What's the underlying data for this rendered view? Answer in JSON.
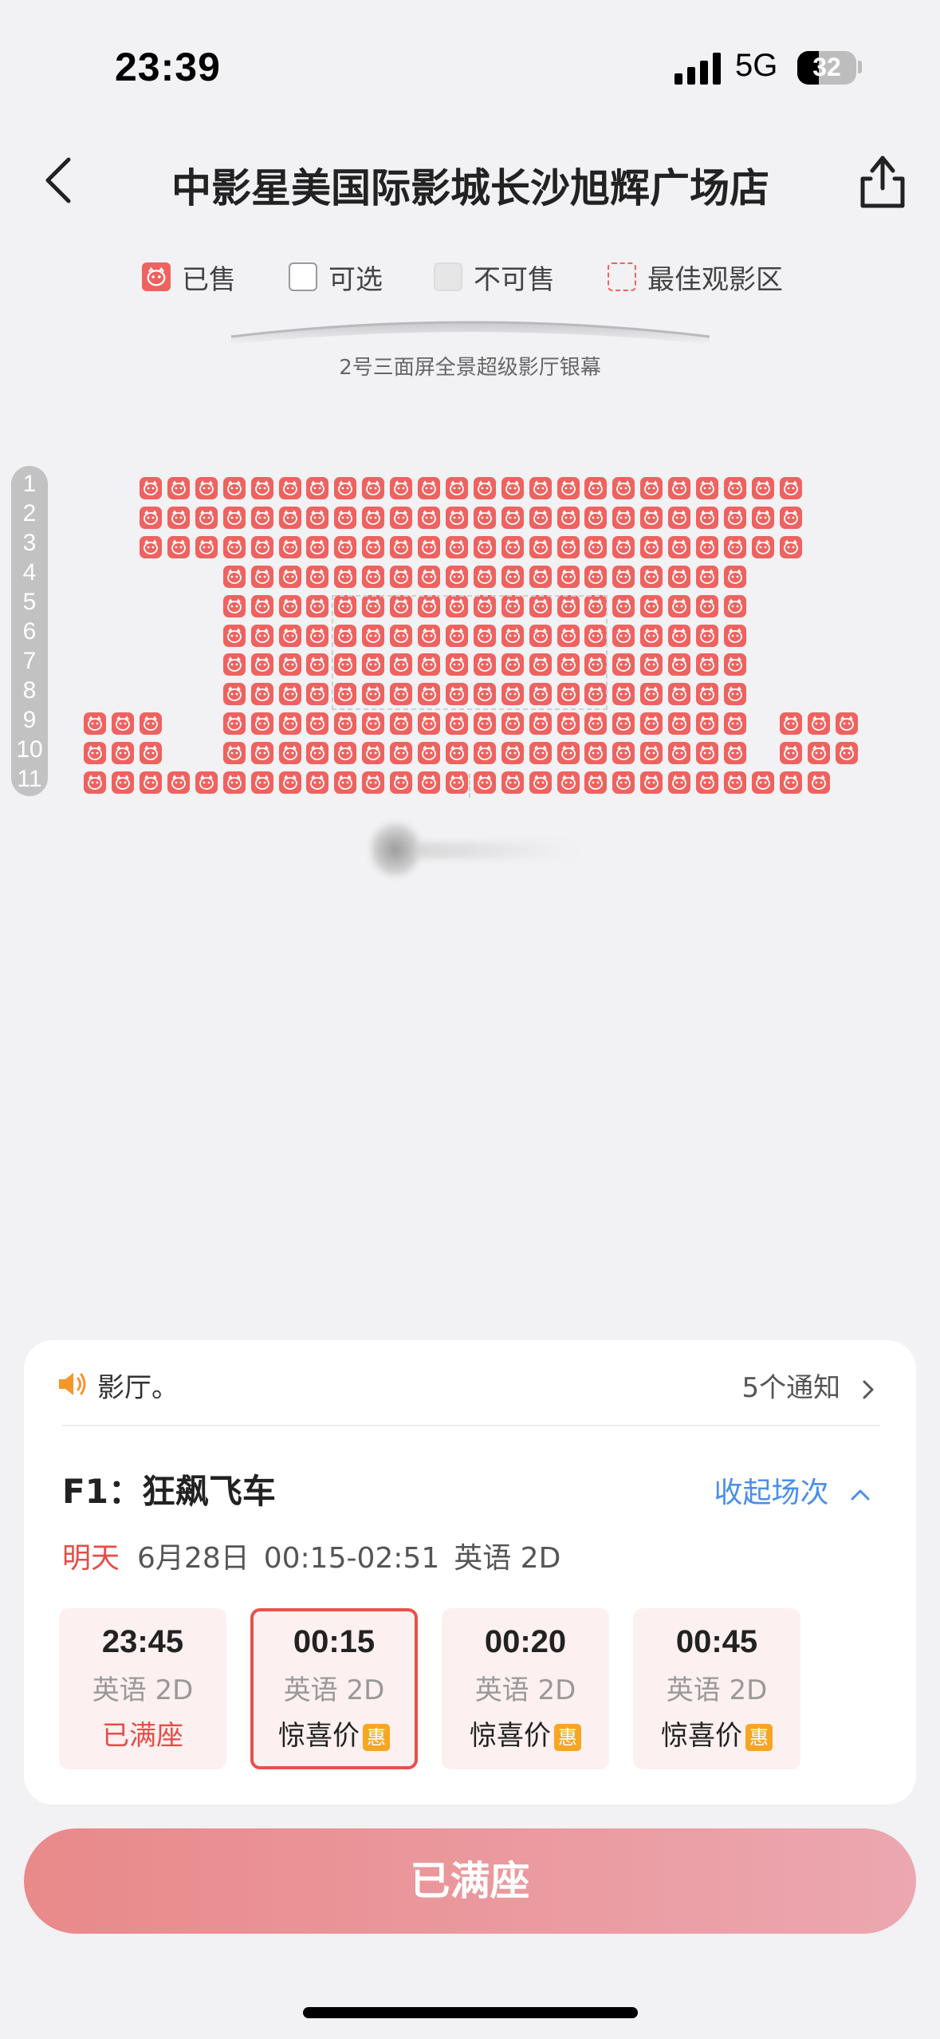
{
  "status_bar": {
    "time": "23:39",
    "network": "5G",
    "battery": "32"
  },
  "nav": {
    "title": "中影星美国际影城长沙旭辉广场店",
    "back_icon": "chevron-left-icon",
    "share_icon": "share-icon"
  },
  "legend": {
    "sold": "已售",
    "available": "可选",
    "unavailable": "不可售",
    "best_zone": "最佳观影区"
  },
  "screen": {
    "label": "2号三面屏全景超级影厅银幕"
  },
  "rows": [
    "1",
    "2",
    "3",
    "4",
    "5",
    "6",
    "7",
    "8",
    "9",
    "10",
    "11"
  ],
  "seat_status": "sold",
  "notice": {
    "text": "影厅。",
    "count": "5个通知"
  },
  "movie": {
    "title": "F1：狂飙飞车",
    "collapse": "收起场次",
    "day": "明天",
    "date": "6月28日",
    "time_range": "00:15-02:51",
    "format": "英语 2D"
  },
  "showtimes": [
    {
      "time": "23:45",
      "lang": "英语 2D",
      "status": "已满座"
    },
    {
      "time": "00:15",
      "lang": "英语 2D",
      "status": "惊喜价",
      "badge": "惠"
    },
    {
      "time": "00:20",
      "lang": "英语 2D",
      "status": "惊喜价",
      "badge": "惠"
    },
    {
      "time": "00:45",
      "lang": "英语 2D",
      "status": "惊喜价",
      "badge": "惠"
    }
  ],
  "action_button": "已满座",
  "colors": {
    "sold_seat": "#ee625f",
    "accent_red": "#e54d47",
    "link_blue": "#4a8ee8",
    "badge_orange": "#f5a623"
  }
}
